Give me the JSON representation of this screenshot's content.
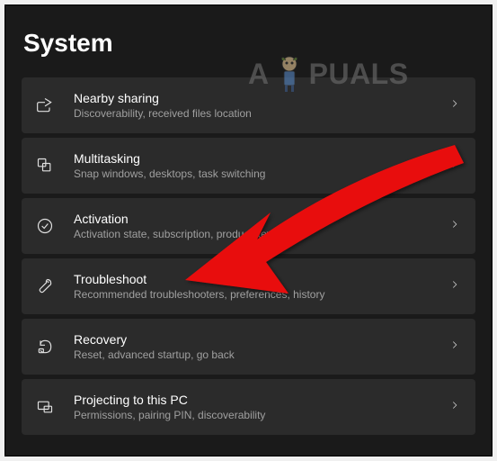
{
  "page_title": "System",
  "watermark": {
    "prefix": "A",
    "suffix": "PUALS"
  },
  "items": [
    {
      "title": "Nearby sharing",
      "subtitle": "Discoverability, received files location"
    },
    {
      "title": "Multitasking",
      "subtitle": "Snap windows, desktops, task switching"
    },
    {
      "title": "Activation",
      "subtitle": "Activation state, subscription, product key"
    },
    {
      "title": "Troubleshoot",
      "subtitle": "Recommended troubleshooters, preferences, history"
    },
    {
      "title": "Recovery",
      "subtitle": "Reset, advanced startup, go back"
    },
    {
      "title": "Projecting to this PC",
      "subtitle": "Permissions, pairing PIN, discoverability"
    }
  ]
}
